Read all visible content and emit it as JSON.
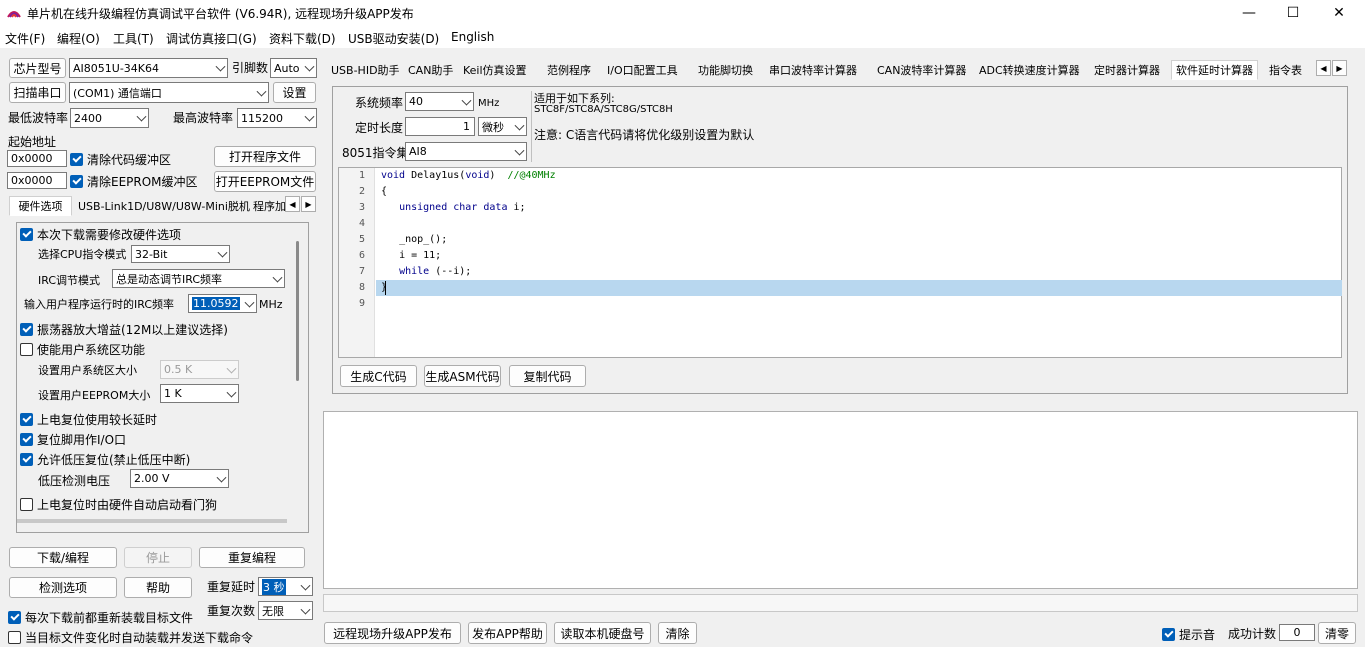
{
  "window": {
    "title": "单片机在线升级编程仿真调试平台软件 (V6.94R), 远程现场升级APP发布",
    "minimize": "—",
    "maximize": "☐",
    "close": "✕"
  },
  "menu": [
    "文件(F)",
    "编程(O)",
    "工具(T)",
    "调试仿真接口(G)",
    "资料下载(D)",
    "USB驱动安装(D)",
    "English"
  ],
  "left": {
    "chip_label": "芯片型号",
    "chip_value": "AI8051U-34K64",
    "pins_label": "引脚数",
    "pins_value": "Auto",
    "scan_button": "扫描串口",
    "port_value": "(COM1) 通信端口",
    "settings_button": "设置",
    "min_baud_label": "最低波特率",
    "min_baud_value": "2400",
    "max_baud_label": "最高波特率",
    "max_baud_value": "115200",
    "start_addr_label": "起始地址",
    "addr1": "0x0000",
    "clear_code_label": "清除代码缓冲区",
    "open_prog_button": "打开程序文件",
    "addr2": "0x0000",
    "clear_eeprom_label": "清除EEPROM缓冲区",
    "open_eeprom_button": "打开EEPROM文件",
    "tabs": [
      "硬件选项",
      "USB-Link1D/U8W/U8W-Mini脱机",
      "程序加"
    ],
    "hw": {
      "modify_label": "本次下载需要修改硬件选项",
      "cpu_mode_label": "选择CPU指令模式",
      "cpu_mode_value": "32-Bit",
      "irc_mode_label": "IRC调节模式",
      "irc_mode_value": "总是动态调节IRC频率",
      "irc_freq_label": "输入用户程序运行时的IRC频率",
      "irc_freq_value": "11.0592",
      "irc_unit": "MHz",
      "osc_gain_label": "振荡器放大增益(12M以上建议选择)",
      "sys_area_label": "使能用户系统区功能",
      "sys_size_label": "设置用户系统区大小",
      "sys_size_value": "0.5 K",
      "eeprom_size_label": "设置用户EEPROM大小",
      "eeprom_size_value": "1   K",
      "long_delay_label": "上电复位使用较长延时",
      "reset_io_label": "复位脚用作I/O口",
      "lvr_label": "允许低压复位(禁止低压中断)",
      "lvd_label": "低压检测电压",
      "lvd_value": "2.00 V",
      "wdt_label": "上电复位时由硬件自动启动看门狗"
    },
    "download_button": "下载/编程",
    "stop_button": "停止",
    "reprogram_button": "重复编程",
    "check_button": "检测选项",
    "help_button": "帮助",
    "repeat_delay_label": "重复延时",
    "repeat_delay_value": "3 秒",
    "repeat_count_label": "重复次数",
    "repeat_count_value": "无限",
    "reload_label": "每次下载前都重新装载目标文件",
    "auto_label": "当目标文件变化时自动装载并发送下载命令"
  },
  "right": {
    "tabs": [
      "USB-HID助手",
      "CAN助手",
      "Keil仿真设置",
      "范例程序",
      "I/O口配置工具",
      "功能脚切换",
      "串口波特率计算器",
      "CAN波特率计算器",
      "ADC转换速度计算器",
      "定时器计算器",
      "软件延时计算器",
      "指令表"
    ],
    "sys_freq_label": "系统频率",
    "sys_freq_value": "40",
    "sys_freq_unit": "MHz",
    "time_label": "定时长度",
    "time_value": "1",
    "time_unit": "微秒",
    "isa_label": "8051指令集",
    "isa_value": "AI8",
    "info": [
      "适用于如下系列:",
      "STC8F/STC8A/STC8G/STC8H",
      "注意: C语言代码请将优化级别设置为默认"
    ],
    "code_lines": [
      {
        "n": "1",
        "text": "void Delay1us(void)\t//@40MHz"
      },
      {
        "n": "2",
        "text": "{"
      },
      {
        "n": "3",
        "text": "\tunsigned char data i;"
      },
      {
        "n": "4",
        "text": ""
      },
      {
        "n": "5",
        "text": "\t_nop_();"
      },
      {
        "n": "6",
        "text": "\ti = 11;"
      },
      {
        "n": "7",
        "text": "\twhile (--i);"
      },
      {
        "n": "8",
        "text": "}"
      },
      {
        "n": "9",
        "text": ""
      }
    ],
    "gen_c_button": "生成C代码",
    "gen_asm_button": "生成ASM代码",
    "copy_button": "复制代码",
    "remote_button": "远程现场升级APP发布",
    "publish_help_button": "发布APP帮助",
    "read_disk_button": "读取本机硬盘号",
    "clear_button": "清除",
    "beep_label": "提示音",
    "success_label": "成功计数",
    "success_value": "0",
    "reset_count_button": "清零"
  },
  "colors": {
    "accent": "#005fb8",
    "highlight": "#b8d7ef"
  }
}
